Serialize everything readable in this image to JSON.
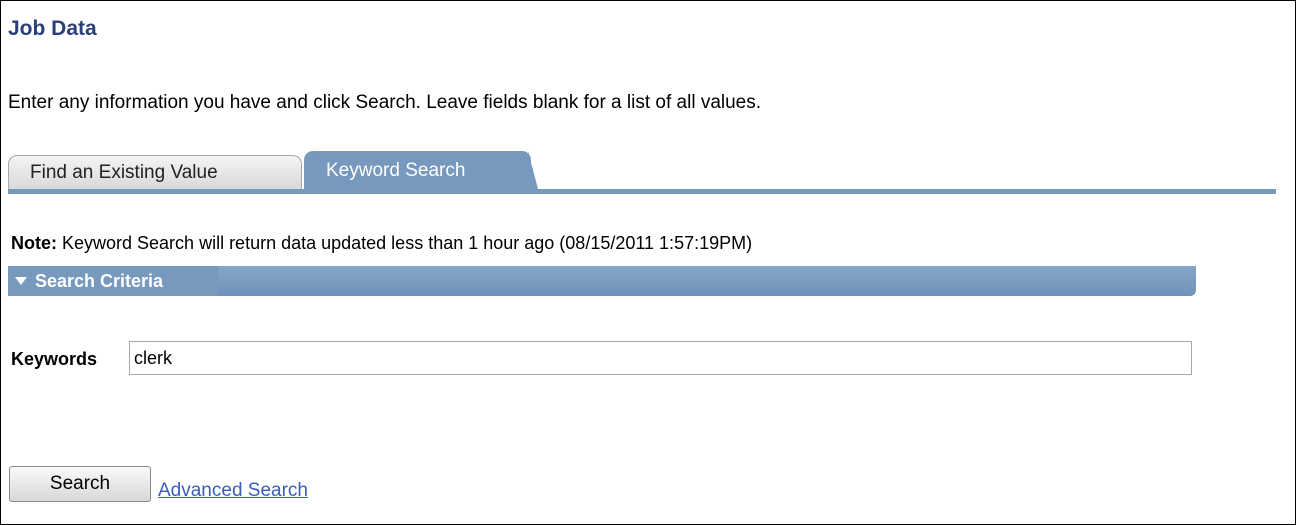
{
  "page": {
    "title": "Job Data",
    "instructions": "Enter any information you have and click Search. Leave fields blank for a list of all values."
  },
  "tabs": [
    {
      "label": "Find an Existing Value",
      "active": false
    },
    {
      "label": "Keyword Search",
      "active": true
    }
  ],
  "note": {
    "label": "Note:",
    "text": " Keyword Search will return data updated less than 1 hour ago (08/15/2011 1:57:19PM)"
  },
  "search_criteria": {
    "title": "Search Criteria",
    "keywords_label": "Keywords",
    "keywords_value": "clerk"
  },
  "actions": {
    "search_label": "Search",
    "advanced_search_label": "Advanced Search"
  },
  "colors": {
    "title": "#2b3f78",
    "tab_active": "#7799be",
    "link": "#3b5dbb"
  }
}
